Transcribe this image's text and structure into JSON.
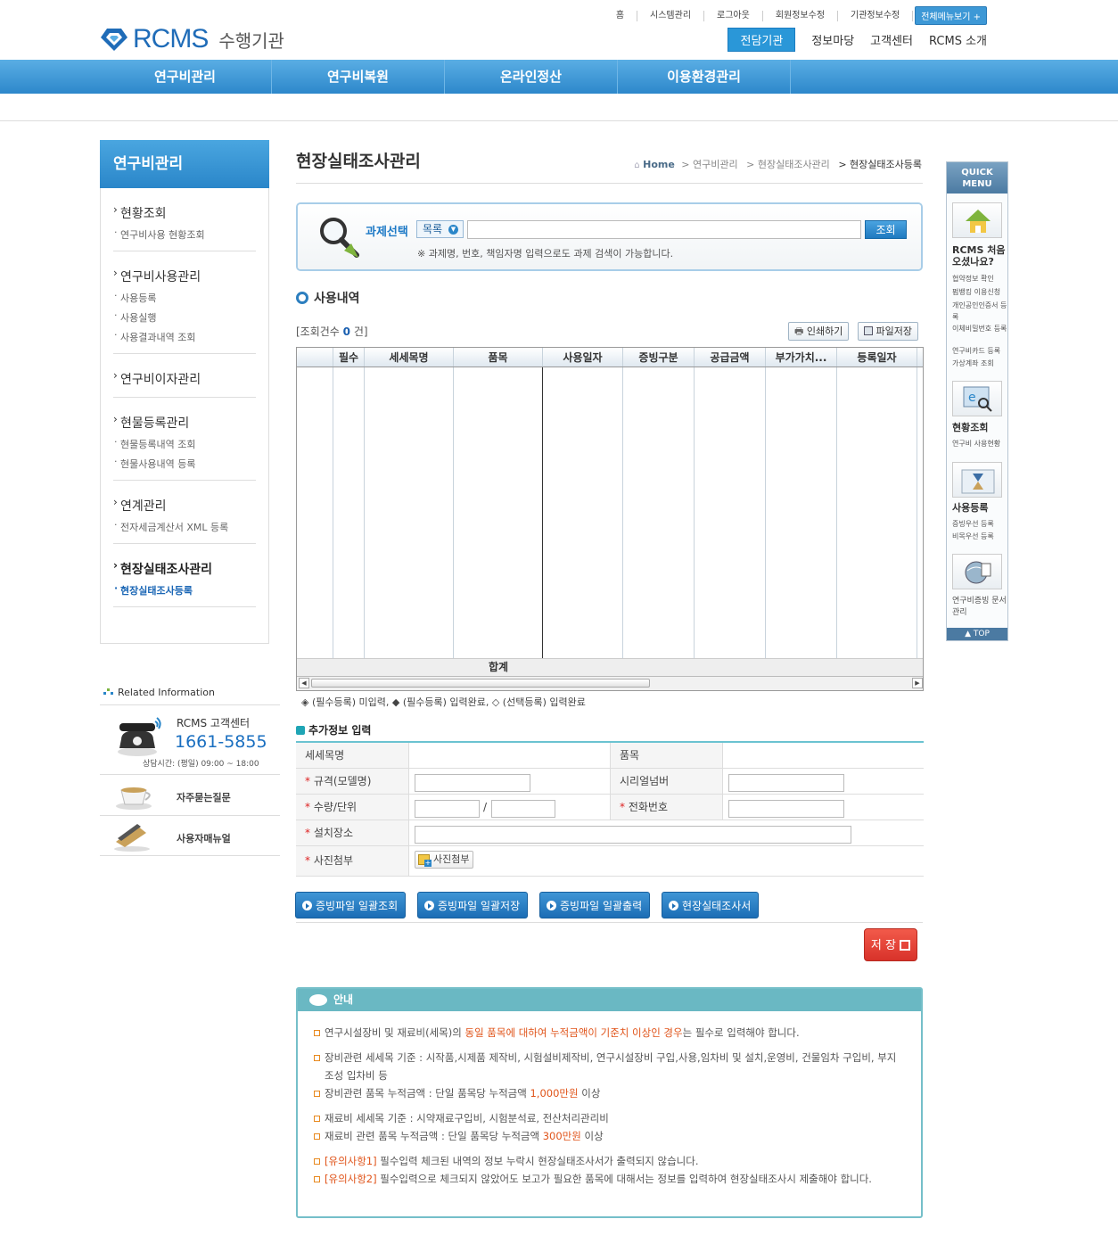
{
  "header": {
    "logo_text": "RCMS",
    "logo_sub": "수행기관",
    "top_links": [
      "홈",
      "시스템관리",
      "로그아웃",
      "회원정보수정",
      "기관정보수정"
    ],
    "all_menu": "전체메뉴보기 +",
    "gnb2": [
      "전담기관",
      "정보마당",
      "고객센터",
      "RCMS 소개"
    ],
    "gnb": [
      "연구비관리",
      "연구비복원",
      "온라인정산",
      "이용환경관리"
    ]
  },
  "lnb": {
    "title": "연구비관리",
    "groups": [
      {
        "title": "현황조회",
        "subs": [
          "연구비사용 현황조회"
        ]
      },
      {
        "title": "연구비사용관리",
        "subs": [
          "사용등록",
          "사용실행",
          "사용결과내역 조회"
        ]
      },
      {
        "title": "연구비이자관리",
        "subs": []
      },
      {
        "title": "현물등록관리",
        "subs": [
          "현물등록내역 조회",
          "현물사용내역 등록"
        ]
      },
      {
        "title": "연계관리",
        "subs": [
          "전자세금계산서 XML 등록"
        ]
      },
      {
        "title": "현장실태조사관리",
        "subs": [
          "현장실태조사등록"
        ]
      }
    ]
  },
  "related": {
    "title": "Related Information",
    "center_label": "RCMS 고객센터",
    "phone": "1661-5855",
    "hours": "상담시간: (평일) 09:00 ~ 18:00",
    "faq": "자주묻는질문",
    "manual": "사용자매뉴얼"
  },
  "content": {
    "title": "현장실태조사관리",
    "breadcrumb": [
      "Home",
      "> 연구비관리",
      "> 현장실태조사관리",
      "> 현장실태조사등록"
    ],
    "search": {
      "label": "과제선택",
      "dropdown": "목록",
      "input_value": "",
      "button": "조회",
      "note": "※ 과제명, 번호, 책임자명 입력으로도 과제 검색이 가능합니다."
    },
    "section1": "사용내역",
    "count_prefix": "[조회건수",
    "count_value": "0",
    "count_suffix": "건]",
    "print_button": "인쇄하기",
    "file_save_button": "파일저장",
    "grid": {
      "columns": [
        "",
        "필수",
        "세세목명",
        "품목",
        "사용일자",
        "증빙구분",
        "공급금액",
        "부가가치...",
        "등록일자"
      ],
      "rows": [],
      "total_label": "합계"
    },
    "legend": "◈ (필수등록) 미입력, ◆ (필수등록) 입력완료, ◇ (선택등록) 입력완료",
    "section2": "추가정보 입력",
    "form": {
      "detail_label": "세세목명",
      "item_label": "품목",
      "spec_label": "규격(모델명)",
      "serial_label": "시리얼넘버",
      "qty_label": "수량/단위",
      "slash": "/",
      "phone_label": "전화번호",
      "place_label": "설치장소",
      "photo_label": "사진첨부",
      "photo_button": "사진첨부",
      "required_mark": "*"
    },
    "action_buttons": [
      "증빙파일 일괄조회",
      "증빙파일 일괄저장",
      "증빙파일 일괄출력",
      "현장실태조사서"
    ],
    "save_button": "저 장",
    "notice": {
      "title": "안내",
      "line1_a": "연구시설장비 및 재료비(세목)의 ",
      "line1_b": "동일 품목에 대하여 누적금액이 기준치 이상인 경우",
      "line1_c": "는 필수로 입력해야 합니다.",
      "line2": "장비관련 세세목 기준 : 시작품,시제품 제작비, 시험설비제작비, 연구시설장비 구입,사용,임차비 및 설치,운영비, 건물임차 구입비, 부지조성 입차비 등",
      "line3_a": "장비관련 품목 누적금액 : 단일 품목당 누적금액 ",
      "line3_b": "1,000만원",
      "line3_c": " 이상",
      "line4": "재료비 세세목 기준 : 시약재료구입비, 시험분석료, 전산처리관리비",
      "line5_a": "재료비 관련 품목 누적금액 : 단일 품목당 누적금액 ",
      "line5_b": "300만원",
      "line5_c": " 이상",
      "line6_a": "[유의사항1]",
      "line6_b": " 필수입력 체크된 내역의 정보 누락시 현장실태조사서가 출력되지 않습니다.",
      "line7_a": "[유의사항2]",
      "line7_b": " 필수입력으로 체크되지 않았어도 보고가 필요한 품목에 대해서는 정보를 입력하여 현장실태조사시 제출해야 합니다."
    }
  },
  "quick": {
    "title1": "QUICK",
    "title2": "MENU",
    "first_title": "RCMS 처음 오셨나요?",
    "first_subs": [
      "협약정보 확인",
      "펌뱅킹 이용신청",
      "개인공인인증서 등록",
      "이체비밀번호 등록",
      "연구비카드 등록",
      "가상계좌 조회"
    ],
    "status_title": "현황조회",
    "status_sub": "연구비 사용현황",
    "use_title": "사용등록",
    "use_subs": [
      "증빙우선 등록",
      "비목우선 등록"
    ],
    "doc_sub": "연구비증빙 문서 관리",
    "top": "▲ TOP"
  },
  "colors": {
    "primary": "#2d88cb",
    "accent_teal": "#6ab8c3",
    "save_red": "#d8322a",
    "highlight_orange": "#e0541a"
  }
}
